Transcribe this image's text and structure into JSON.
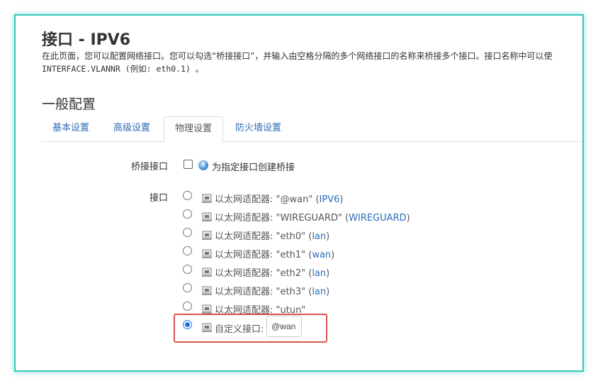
{
  "header": {
    "title": "接口 - IPV6",
    "description_line1": "在此页面，您可以配置网络接口。您可以勾选“桥接接口”，并输入由空格分隔的多个网络接口的名称来桥接多个接口。接口名称中可以使",
    "description_line2": "INTERFACE.VLANNR (例如: eth0.1) 。"
  },
  "section": {
    "title": "一般配置"
  },
  "tabs": [
    {
      "label": "基本设置",
      "active": false
    },
    {
      "label": "高级设置",
      "active": false
    },
    {
      "label": "物理设置",
      "active": true
    },
    {
      "label": "防火墙设置",
      "active": false
    }
  ],
  "bridge": {
    "label": "桥接接口",
    "checked": false,
    "help_text": "为指定接口创建桥接"
  },
  "interface": {
    "label": "接口",
    "options": [
      {
        "prefix": "以太网适配器: ",
        "name": "\"@wan\"",
        "net_open": " (",
        "net": "IPV6",
        "net_close": ")",
        "checked": false
      },
      {
        "prefix": "以太网适配器: ",
        "name": "\"WIREGUARD\"",
        "net_open": " (",
        "net": "WIREGUARD",
        "net_close": ")",
        "checked": false
      },
      {
        "prefix": "以太网适配器: ",
        "name": "\"eth0\"",
        "net_open": " (",
        "net": "lan",
        "net_close": ")",
        "checked": false
      },
      {
        "prefix": "以太网适配器: ",
        "name": "\"eth1\"",
        "net_open": " (",
        "net": "wan",
        "net_close": ")",
        "checked": false
      },
      {
        "prefix": "以太网适配器: ",
        "name": "\"eth2\"",
        "net_open": " (",
        "net": "lan",
        "net_close": ")",
        "checked": false
      },
      {
        "prefix": "以太网适配器: ",
        "name": "\"eth3\"",
        "net_open": " (",
        "net": "lan",
        "net_close": ")",
        "checked": false
      },
      {
        "prefix": "以太网适配器: ",
        "name": "\"utun\"",
        "net_open": "",
        "net": "",
        "net_close": "",
        "checked": false
      }
    ],
    "custom": {
      "label": "自定义接口:",
      "value": "@wan",
      "checked": true
    }
  },
  "icons": {
    "help": "help-circle-icon",
    "ethernet": "ethernet-adapter-icon"
  },
  "colors": {
    "frame_border": "#33c7b8",
    "link": "#2a6cb8",
    "highlight": "#d9534f",
    "radio_checked": "#1a73e8"
  }
}
